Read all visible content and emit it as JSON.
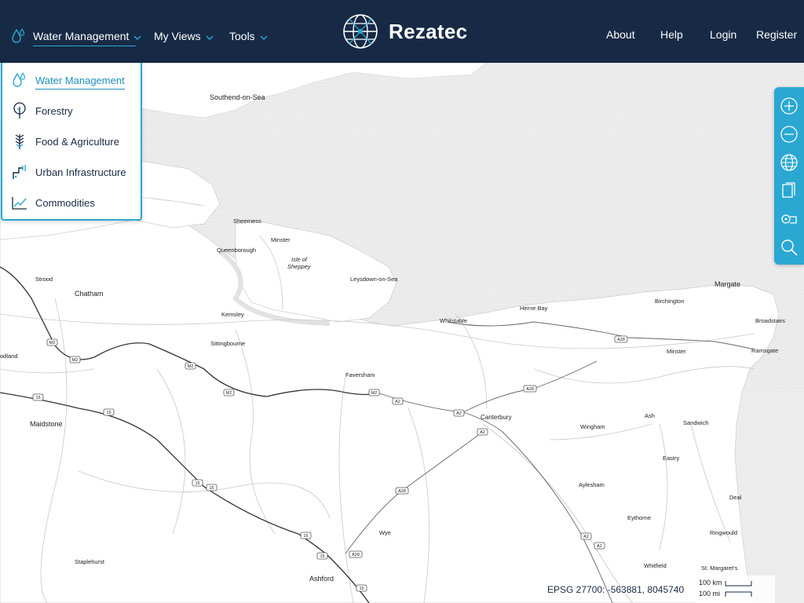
{
  "nav": {
    "water_management": "Water Management",
    "my_views": "My Views",
    "tools": "Tools",
    "brand": "Rezatec",
    "about": "About",
    "help": "Help",
    "login": "Login",
    "register": "Register"
  },
  "dropdown": {
    "items": [
      {
        "label": "Water Management",
        "icon": "water-drop-icon",
        "active": true
      },
      {
        "label": "Forestry",
        "icon": "tree-icon",
        "active": false
      },
      {
        "label": "Food & Agriculture",
        "icon": "wheat-icon",
        "active": false
      },
      {
        "label": "Urban Infrastructure",
        "icon": "pipe-icon",
        "active": false
      },
      {
        "label": "Commodities",
        "icon": "chart-icon",
        "active": false
      }
    ]
  },
  "toolbar": [
    "zoom-in-icon",
    "zoom-out-icon",
    "globe-icon",
    "layers-icon",
    "legend-icon",
    "search-icon"
  ],
  "map": {
    "places": {
      "southend": "Southend-on-Sea",
      "sheerness": "Sheerness",
      "minster1": "Minster",
      "queenborough": "Queenborough",
      "isle1": "Isle of",
      "isle2": "Sheppey",
      "leysdown": "Leysdown-on-Sea",
      "strood": "Strood",
      "chatham": "Chatham",
      "kemsley": "Kemsley",
      "sittingbourne": "Sittingbourne",
      "faversham": "Faversham",
      "whitstable": "Whitstable",
      "hernebay": "Herne Bay",
      "birchington": "Birchington",
      "margate": "Margate",
      "broadstairs": "Broadstairs",
      "minster2": "Minster",
      "ramsgate": "Ramsgate",
      "odland": "odland",
      "maidstone": "Maidstone",
      "canterbury": "Canterbury",
      "wingham": "Wingham",
      "ash": "Ash",
      "sandwich": "Sandwich",
      "eastry": "Eastry",
      "aylesham": "Aylesham",
      "deal": "Deal",
      "eythorne": "Eythorne",
      "ringwould": "Ringwould",
      "wye": "Wye",
      "staplehurst": "Staplehurst",
      "whitfield": "Whitfield",
      "stmargarets": "St. Margaret's",
      "ashford": "Ashford"
    },
    "roads": {
      "m2a": "M2",
      "m2b": "M2",
      "m2c": "M2",
      "m2d": "M2",
      "m2e": "M2",
      "a2a": "A2",
      "a2b": "A2",
      "a2c": "A2",
      "a2d": "A2",
      "a2e": "A2",
      "a28a": "A28",
      "a28b": "A28",
      "a28c": "A28",
      "a28d": "A28",
      "m20a": "15",
      "m20b": "15",
      "m20c": "15",
      "m20d": "15",
      "m20e": "15",
      "m20f": "15",
      "m20g": "15"
    }
  },
  "status": {
    "coords": "EPSG 27700: -563881, 8045740",
    "scale_km": "100 km",
    "scale_mi": "100 mi"
  }
}
